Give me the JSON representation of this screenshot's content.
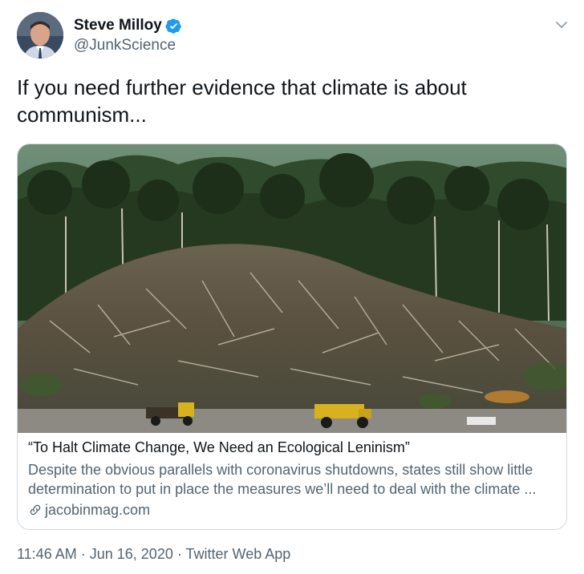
{
  "tweet": {
    "display_name": "Steve Milloy",
    "handle": "@JunkScience",
    "text": "If you need further evidence that climate is about communism...",
    "verified": true
  },
  "card": {
    "title": "“To Halt Climate Change, We Need an Ecological Leninism”",
    "description": "Despite the obvious parallels with coronavirus shutdowns, states still show little determination to put in place the measures we’ll need to deal with the climate ...",
    "domain": "jacobinmag.com"
  },
  "meta": {
    "time": "11:46 AM",
    "date": "Jun 16, 2020",
    "source": "Twitter Web App",
    "separator": "·"
  },
  "colors": {
    "verified_badge": "#1d9bf0",
    "secondary_text": "#536471",
    "border": "#cfd9de"
  },
  "icons": {
    "verified": "verified-badge-icon",
    "more": "chevron-down-icon",
    "link": "link-icon"
  }
}
